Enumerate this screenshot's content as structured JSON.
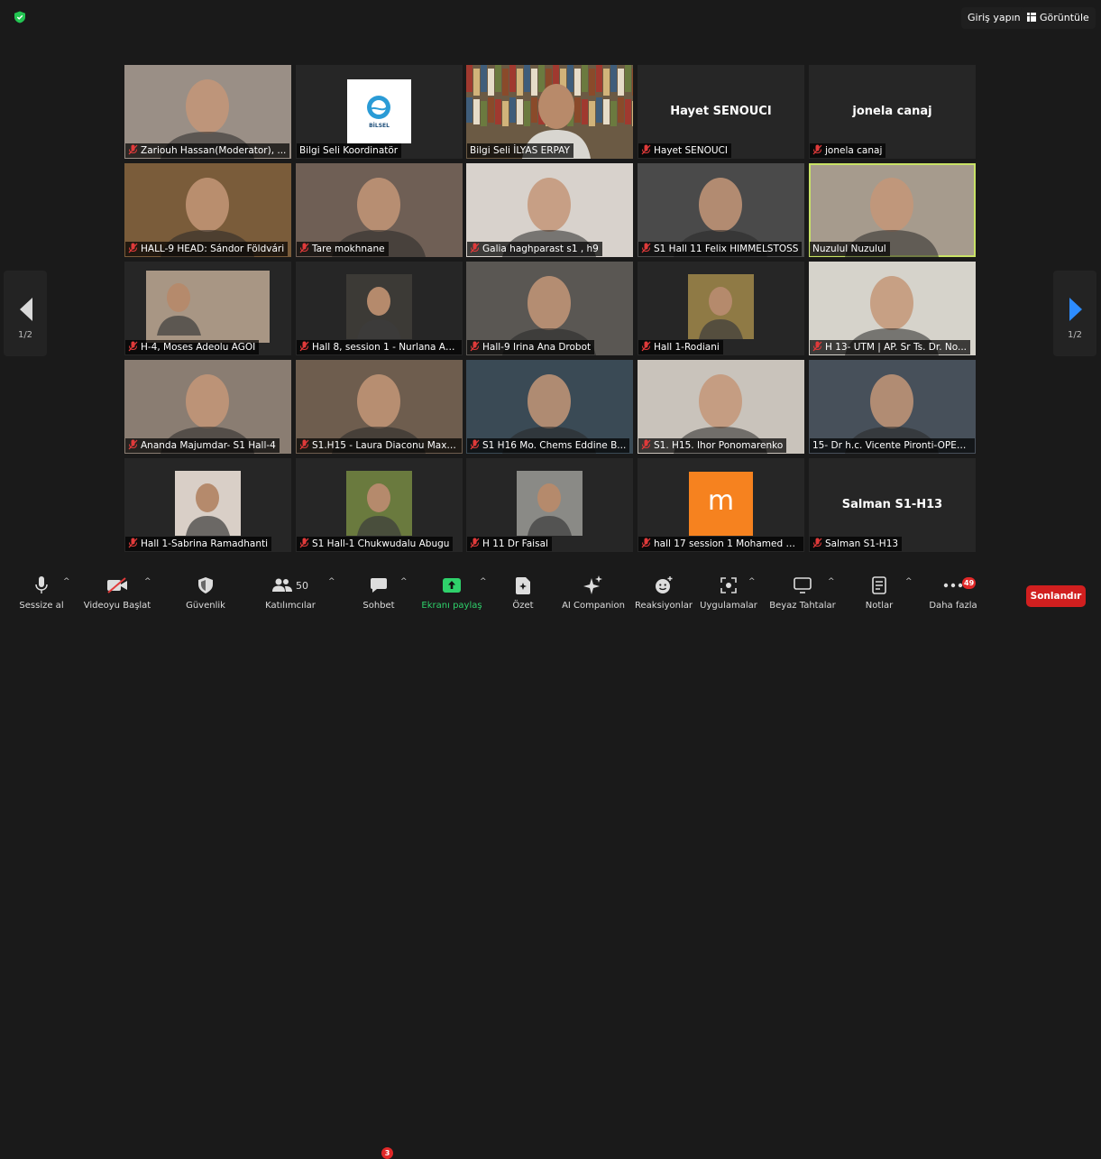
{
  "top": {
    "signin_label": "Giriş yapın",
    "view_label": "Görüntüle"
  },
  "nav": {
    "page_left": "1/2",
    "page_right": "1/2"
  },
  "tiles": [
    {
      "name": "Zariouh Hassan(Moderator), ...",
      "muted": true,
      "bg": "#9a8f86",
      "video": "face"
    },
    {
      "name": "Bilgi Seli Koordinatör",
      "muted": false,
      "bg": "#262626",
      "video": "logo",
      "logo_text": "BİLSEL"
    },
    {
      "name": "Bilgi Seli İLYAS ERPAY",
      "muted": false,
      "bg": "#6b5a44",
      "video": "books"
    },
    {
      "name": "Hayet SENOUCI",
      "muted": true,
      "bg": "#262626",
      "video": "none",
      "big": "Hayet SENOUCI"
    },
    {
      "name": "jonela canaj",
      "muted": true,
      "bg": "#262626",
      "video": "none",
      "big": "jonela canaj"
    },
    {
      "name": "HALL-9 HEAD: Sándor Földvári",
      "muted": true,
      "bg": "#7a5c3a",
      "video": "face"
    },
    {
      "name": "Tare mokhnane",
      "muted": true,
      "bg": "#6f5f55",
      "video": "face"
    },
    {
      "name": "Galia haghparast s1 , h9",
      "muted": true,
      "bg": "#d8d2cc",
      "video": "face"
    },
    {
      "name": "S1 Hall 11 Felix HIMMELSTOSS",
      "muted": true,
      "bg": "#4a4a4a",
      "video": "face"
    },
    {
      "name": "Nuzulul Nuzulul",
      "muted": false,
      "bg": "#a69b8d",
      "video": "face",
      "active": true
    },
    {
      "name": "H-4, Moses Adeolu AGOI",
      "muted": true,
      "bg": "#262626",
      "video": "inset",
      "inset_bg": "#a89684"
    },
    {
      "name": "Hall 8, session 1 - Nurlana Ag...",
      "muted": true,
      "bg": "#262626",
      "video": "inset",
      "inset_bg": "#3c3a36"
    },
    {
      "name": "Hall-9 Irina Ana Drobot",
      "muted": true,
      "bg": "#5a5753",
      "video": "face"
    },
    {
      "name": "Hall 1-Rodiani",
      "muted": true,
      "bg": "#262626",
      "video": "inset",
      "inset_bg": "#8f7a45"
    },
    {
      "name": "H 13- UTM | AP. Sr Ts. Dr. No...",
      "muted": true,
      "bg": "#d6d3cb",
      "video": "face"
    },
    {
      "name": "Ananda Majumdar- S1 Hall-4",
      "muted": true,
      "bg": "#8a7d72",
      "video": "face"
    },
    {
      "name": "S1.H15 - Laura Diaconu Maxim",
      "muted": true,
      "bg": "#6e5d4e",
      "video": "face"
    },
    {
      "name": "S1 H16 Mo.  Chems Eddine B...",
      "muted": true,
      "bg": "#3a4a55",
      "video": "face"
    },
    {
      "name": "S1. H15. Ihor Ponomarenko",
      "muted": true,
      "bg": "#c9c3bb",
      "video": "face"
    },
    {
      "name": "15- Dr h.c. Vicente Pironti-OPEN ...",
      "muted": false,
      "bg": "#47505a",
      "video": "face"
    },
    {
      "name": "Hall 1-Sabrina Ramadhanti",
      "muted": true,
      "bg": "#262626",
      "video": "inset",
      "inset_bg": "#d9cfc7"
    },
    {
      "name": "S1 Hall-1 Chukwudalu Abugu",
      "muted": true,
      "bg": "#262626",
      "video": "inset",
      "inset_bg": "#6a7a3e"
    },
    {
      "name": "H 11 Dr Faisal",
      "muted": true,
      "bg": "#262626",
      "video": "inset",
      "inset_bg": "#8a8a86"
    },
    {
      "name": "hall 17 session 1 Mohamed B...",
      "muted": true,
      "bg": "#262626",
      "video": "mlogo",
      "letter": "m"
    },
    {
      "name": "Salman S1-H13",
      "muted": true,
      "bg": "#262626",
      "video": "none",
      "big": "Salman S1-H13"
    }
  ],
  "toolbar": {
    "mute": "Sessize al",
    "video": "Videoyu Başlat",
    "security": "Güvenlik",
    "participants": "Katılımcılar",
    "participants_count": "50",
    "chat": "Sohbet",
    "chat_badge": "3",
    "share": "Ekranı paylaş",
    "summary": "Özet",
    "ai": "AI Companion",
    "reactions": "Reaksiyonlar",
    "apps": "Uygulamalar",
    "whiteboard": "Beyaz Tahtalar",
    "notes": "Notlar",
    "more": "Daha fazla",
    "more_badge": "49",
    "end": "Sonlandır"
  },
  "colors": {
    "share_green": "#2fd16b",
    "end_red": "#d11f1f",
    "active_border": "#c9e266",
    "mic_red": "#e03a3a"
  }
}
